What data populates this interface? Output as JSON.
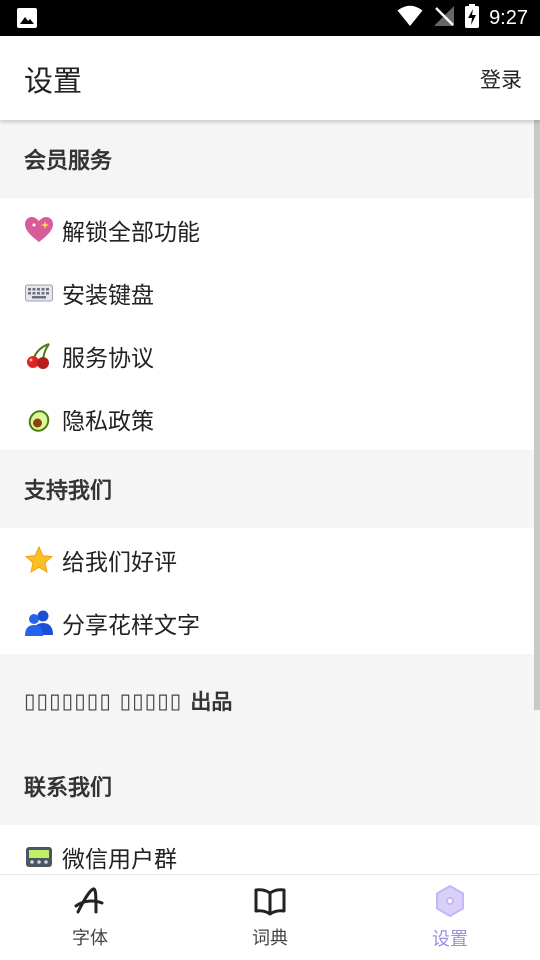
{
  "status_bar": {
    "time": "9:27",
    "left_icon": "image-icon",
    "right_icons": [
      "wifi-icon",
      "no-signal-icon",
      "battery-charging-icon"
    ]
  },
  "app_bar": {
    "title": "设置",
    "login_label": "登录"
  },
  "sections": [
    {
      "header": "会员服务",
      "items": [
        {
          "icon": "sparkling-heart-icon",
          "label": "解锁全部功能"
        },
        {
          "icon": "keyboard-icon",
          "label": "安装键盘"
        },
        {
          "icon": "cherries-icon",
          "label": "服务协议"
        },
        {
          "icon": "avocado-icon",
          "label": "隐私政策"
        }
      ]
    },
    {
      "header": "支持我们",
      "items": [
        {
          "icon": "star-icon",
          "label": "给我们好评"
        },
        {
          "icon": "people-icon",
          "label": "分享花样文字"
        }
      ]
    }
  ],
  "credit": {
    "unrendered_text": "▯▯▯▯▯▯▯ ▯▯▯▯▯",
    "produced_label": "出品"
  },
  "contact": {
    "header": "联系我们",
    "items": [
      {
        "icon": "pager-icon",
        "label": "微信用户群"
      }
    ]
  },
  "bottom_nav": [
    {
      "icon": "font-a-icon",
      "label": "字体",
      "active": false
    },
    {
      "icon": "book-icon",
      "label": "词典",
      "active": false
    },
    {
      "icon": "settings-badge-icon",
      "label": "设置",
      "active": true
    }
  ],
  "colors": {
    "accent": "#9b8fe0",
    "section_bg": "#f5f5f5",
    "status_bar": "#000000"
  }
}
